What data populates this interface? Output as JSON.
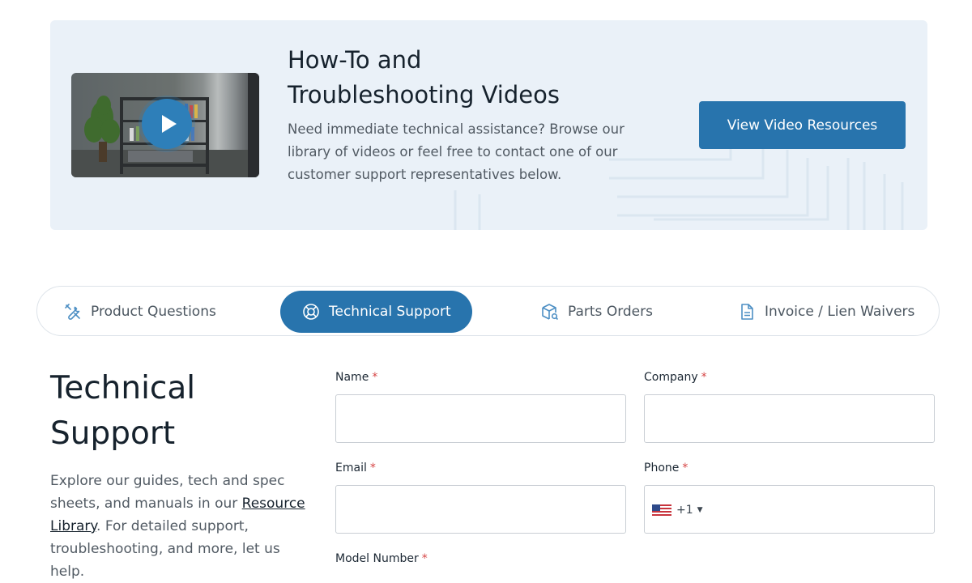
{
  "banner": {
    "title_line1": "How-To and",
    "title_line2": "Troubleshooting Videos",
    "description": "Need immediate technical assistance? Browse our library of videos or feel free to contact one of our customer support representatives below.",
    "button_label": "View Video Resources"
  },
  "tabs": [
    {
      "label": "Product Questions",
      "icon": "tools-icon",
      "active": false
    },
    {
      "label": "Technical Support",
      "icon": "lifebuoy-icon",
      "active": true
    },
    {
      "label": "Parts Orders",
      "icon": "box-search-icon",
      "active": false
    },
    {
      "label": "Invoice / Lien Waivers",
      "icon": "document-icon",
      "active": false
    }
  ],
  "section": {
    "title_line1": "Technical",
    "title_line2": "Support",
    "text_before_link": "Explore our guides, tech and spec sheets, and manuals in our ",
    "link_text": "Resource Library",
    "text_after_link": ". For detailed support, troubleshooting, and more, let us help."
  },
  "form": {
    "required_marker": "*",
    "name_label": "Name",
    "company_label": "Company",
    "email_label": "Email",
    "phone_label": "Phone",
    "model_label": "Model Number",
    "phone_country_code": "+1",
    "phone_flag": "us-flag-icon"
  },
  "colors": {
    "accent": "#2874ad",
    "banner_bg": "#eaf1f8",
    "required": "#d64545"
  }
}
